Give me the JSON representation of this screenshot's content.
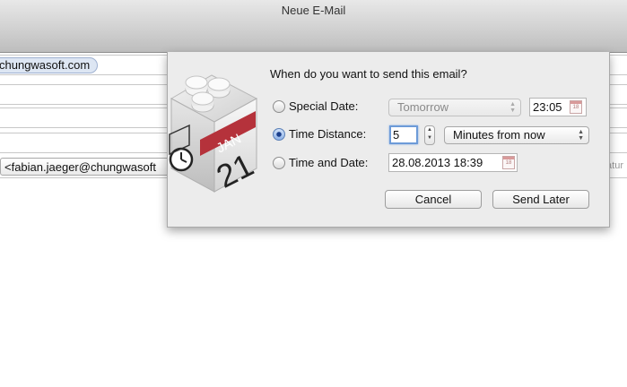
{
  "window": {
    "title": "Neue E-Mail"
  },
  "mail_fields": {
    "to_token": "chungwasoft.com",
    "from_value": "<fabian.jaeger@chungwasoft",
    "signature_label": "Signatur"
  },
  "dialog": {
    "question": "When do you want to send this email?",
    "app_icon": {
      "name": "calendar-app-icon",
      "month": "JAN",
      "day": "21"
    },
    "special_date": {
      "label": "Special Date:",
      "selected": false,
      "popup_value": "Tomorrow",
      "time_value": "23:05"
    },
    "time_distance": {
      "label": "Time Distance:",
      "selected": true,
      "amount_value": "5",
      "unit_value": "Minutes from now"
    },
    "time_and_date": {
      "label": "Time and Date:",
      "selected": false,
      "datetime_value": "28.08.2013 18:39"
    },
    "calendar_icon_day": "18",
    "buttons": {
      "cancel": "Cancel",
      "send_later": "Send Later"
    }
  }
}
